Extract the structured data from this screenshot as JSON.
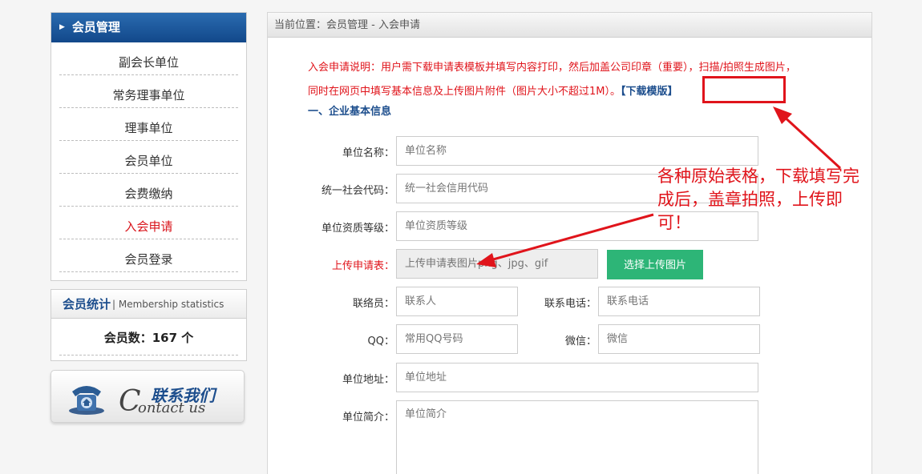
{
  "sidebar": {
    "title": "会员管理",
    "items": [
      {
        "label": "副会长单位",
        "active": false
      },
      {
        "label": "常务理事单位",
        "active": false
      },
      {
        "label": "理事单位",
        "active": false
      },
      {
        "label": "会员单位",
        "active": false
      },
      {
        "label": "会费缴纳",
        "active": false
      },
      {
        "label": "入会申请",
        "active": true
      },
      {
        "label": "会员登录",
        "active": false
      }
    ]
  },
  "stats": {
    "title_zh": "会员统计",
    "title_en": "| Membership statistics",
    "member_count": "会员数：167 个"
  },
  "contact": {
    "title_zh": "联系我们",
    "title_en_c": "C",
    "title_en_rest": "ontact us"
  },
  "breadcrumb": "当前位置：会员管理 - 入会申请",
  "notice": {
    "text": "入会申请说明：用户需下载申请表模板并填写内容打印，然后加盖公司印章（重要），扫描/拍照生成图片，同时在网页中填写基本信息及上传图片附件（图片大小不超过1M）。",
    "download_label": "【下载模版】"
  },
  "section_title": "一、企业基本信息",
  "form": {
    "name_label": "单位名称：",
    "name_placeholder": "单位名称",
    "credit_label": "统一社会代码：",
    "credit_placeholder": "统一社会信用代码",
    "grade_label": "单位资质等级：",
    "grade_placeholder": "单位资质等级",
    "upload_label": "上传申请表：",
    "upload_placeholder": "上传申请表图片png、jpg、gif",
    "upload_button": "选择上传图片",
    "contact_label": "联络员：",
    "contact_placeholder": "联系人",
    "phone_label": "联系电话：",
    "phone_placeholder": "联系电话",
    "qq_label": "QQ：",
    "qq_placeholder": "常用QQ号码",
    "wechat_label": "微信：",
    "wechat_placeholder": "微信",
    "address_label": "单位地址：",
    "address_placeholder": "单位地址",
    "intro_label": "单位简介：",
    "intro_placeholder": "单位简介"
  },
  "annotation": "各种原始表格，下载填写完成后，盖章拍照，上传即可！",
  "colors": {
    "accent_blue": "#1d4e8d",
    "alert_red": "#e0141b",
    "button_green": "#2db577"
  }
}
